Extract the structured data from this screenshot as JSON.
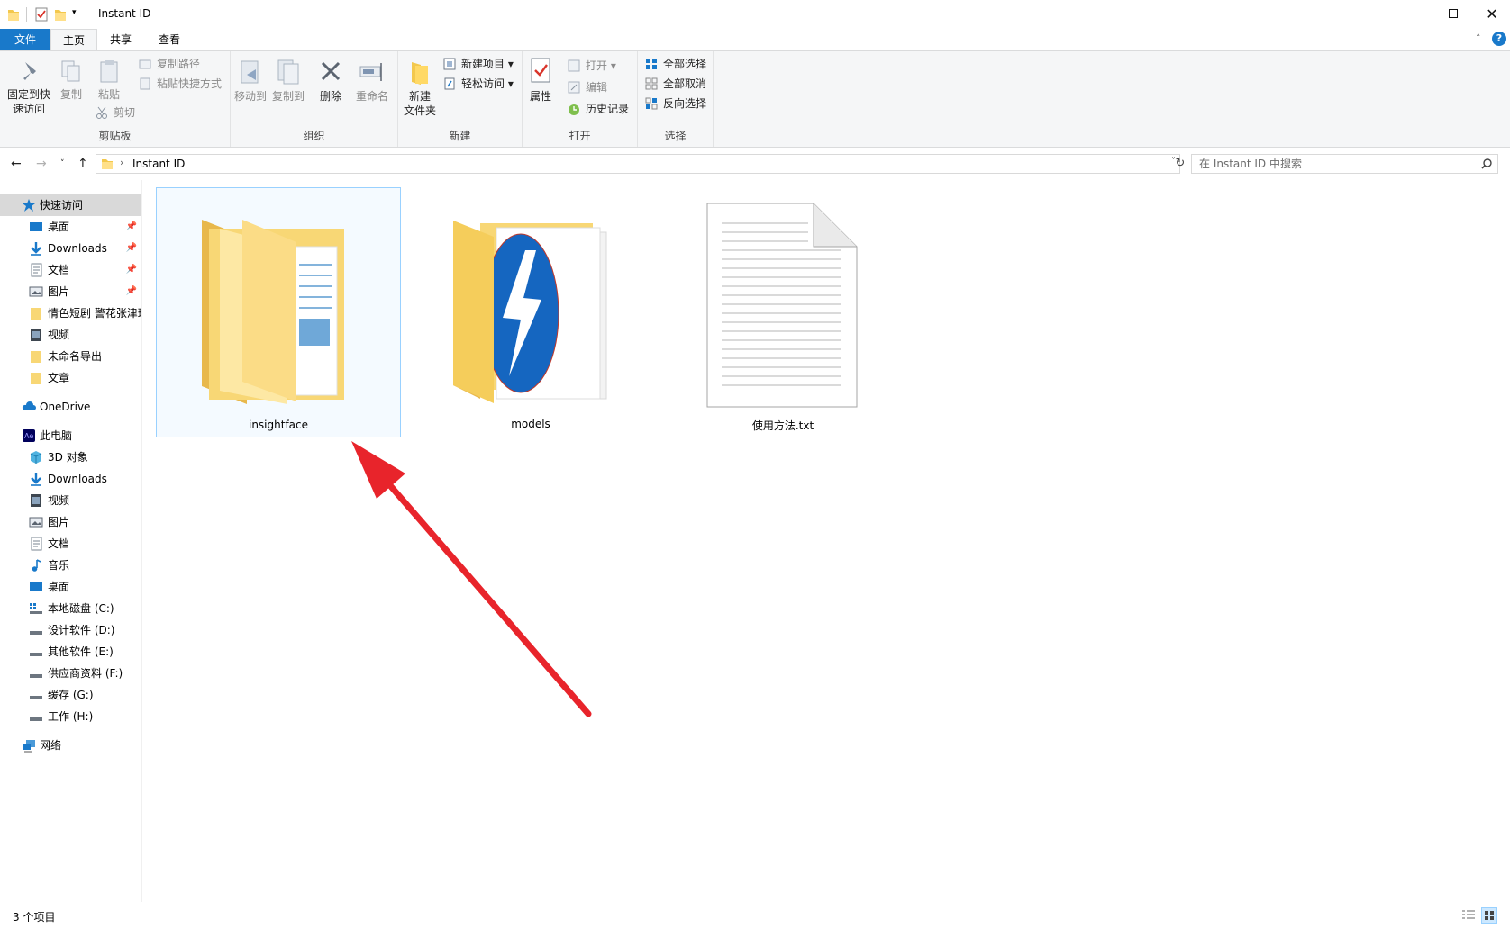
{
  "window": {
    "title": "Instant ID"
  },
  "tabs": [
    {
      "label": "文件"
    },
    {
      "label": "主页"
    },
    {
      "label": "共享"
    },
    {
      "label": "查看"
    }
  ],
  "ribbon": {
    "clipboard": {
      "label": "剪贴板",
      "pin": "固定到快\n速访问",
      "pin_l1": "固定到快",
      "pin_l2": "速访问",
      "copy": "复制",
      "paste": "粘贴",
      "copy_path": "复制路径",
      "paste_shortcut": "粘贴快捷方式",
      "cut": "剪切"
    },
    "organize": {
      "label": "组织",
      "move_to": "移动到",
      "copy_to": "复制到",
      "delete": "删除",
      "rename": "重命名"
    },
    "new": {
      "label": "新建",
      "new_folder_l1": "新建",
      "new_folder_l2": "文件夹",
      "new_item": "新建项目",
      "easy_access": "轻松访问"
    },
    "open": {
      "label": "打开",
      "properties": "属性",
      "open": "打开",
      "edit": "编辑",
      "history": "历史记录"
    },
    "select": {
      "label": "选择",
      "select_all": "全部选择",
      "select_none": "全部取消",
      "invert": "反向选择"
    }
  },
  "address": {
    "path": "Instant ID",
    "search_placeholder": "在 Instant ID 中搜索"
  },
  "sidebar": {
    "quick_access": "快速访问",
    "quick_items": [
      {
        "label": "桌面",
        "pinned": true
      },
      {
        "label": "Downloads",
        "pinned": true
      },
      {
        "label": "文档",
        "pinned": true
      },
      {
        "label": "图片",
        "pinned": true
      },
      {
        "label": "情色短剧 警花张津瑜"
      },
      {
        "label": "视频"
      },
      {
        "label": "未命名导出"
      },
      {
        "label": "文章"
      }
    ],
    "onedrive": "OneDrive",
    "this_pc": "此电脑",
    "pc_items": [
      {
        "label": "3D 对象"
      },
      {
        "label": "Downloads"
      },
      {
        "label": "视频"
      },
      {
        "label": "图片"
      },
      {
        "label": "文档"
      },
      {
        "label": "音乐"
      },
      {
        "label": "桌面"
      },
      {
        "label": "本地磁盘 (C:)"
      },
      {
        "label": "设计软件 (D:)"
      },
      {
        "label": "其他软件 (E:)"
      },
      {
        "label": "供应商资料 (F:)"
      },
      {
        "label": "缓存 (G:)"
      },
      {
        "label": "工作 (H:)"
      }
    ],
    "network": "网络"
  },
  "files": [
    {
      "name": "insightface",
      "type": "folder",
      "selected": true
    },
    {
      "name": "models",
      "type": "folder"
    },
    {
      "name": "使用方法.txt",
      "type": "text-file"
    }
  ],
  "status": {
    "count": "3 个项目"
  },
  "colors": {
    "accent": "#1979ca",
    "folder": "#f8d775",
    "annotation_arrow": "#e8242b"
  }
}
